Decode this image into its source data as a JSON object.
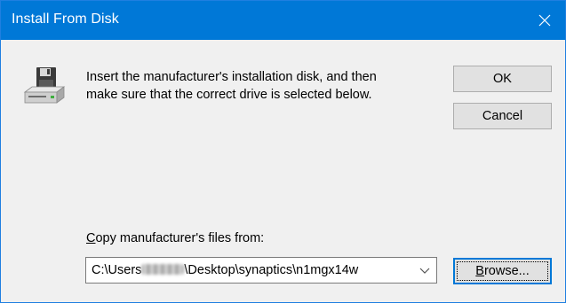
{
  "window": {
    "title": "Install From Disk",
    "accent_color": "#0078d7",
    "close_icon": "close-icon"
  },
  "message": {
    "line1": "Insert the manufacturer's installation disk, and then",
    "line2": "make sure that the correct drive is selected below.",
    "icon": "floppy-drive-icon"
  },
  "buttons": {
    "ok": "OK",
    "cancel": "Cancel",
    "browse_mnemonic": "B",
    "browse_rest": "rowse..."
  },
  "copy_from": {
    "label_mnemonic": "C",
    "label_rest": "opy manufacturer's files from:",
    "path_prefix": "C:\\Users",
    "path_suffix": "\\Desktop\\synaptics\\n1mgx14w"
  }
}
